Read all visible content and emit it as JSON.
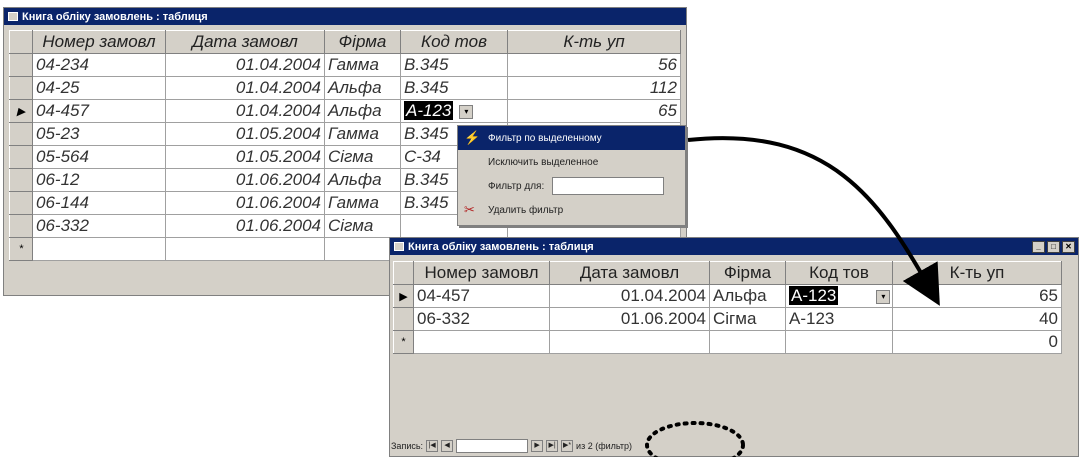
{
  "window1": {
    "title": "Книга обліку замовлень : таблиця",
    "columns": [
      "Номер замовл",
      "Дата замовл",
      "Фірма",
      "Код тов",
      "К-ть уп"
    ],
    "rows": [
      [
        "04-234",
        "01.04.2004",
        "Гамма",
        "B.345",
        "56"
      ],
      [
        "04-25",
        "01.04.2004",
        "Альфа",
        "B.345",
        "112"
      ],
      [
        "04-457",
        "01.04.2004",
        "Альфа",
        "A-123",
        "65"
      ],
      [
        "05-23",
        "01.05.2004",
        "Гамма",
        "B.345",
        ""
      ],
      [
        "05-564",
        "01.05.2004",
        "Сігма",
        "C-34",
        ""
      ],
      [
        "06-12",
        "01.06.2004",
        "Альфа",
        "B.345",
        ""
      ],
      [
        "06-144",
        "01.06.2004",
        "Гамма",
        "B.345",
        ""
      ],
      [
        "06-332",
        "01.06.2004",
        "Сігма",
        "",
        ""
      ]
    ],
    "current_row_marker": "▶",
    "new_row_marker": "*"
  },
  "context_menu": {
    "items": [
      {
        "label": "Фильтр по выделенному",
        "icon": "filter-selection-icon"
      },
      {
        "label": "Исключить выделенное",
        "icon": ""
      },
      {
        "label": "Фильтр для:",
        "icon": ""
      },
      {
        "label": "Удалить фильтр",
        "icon": "remove-filter-icon"
      }
    ]
  },
  "window2": {
    "title": "Книга обліку замовлень : таблиця",
    "columns": [
      "Номер замовл",
      "Дата замовл",
      "Фірма",
      "Код тов",
      "К-ть уп"
    ],
    "rows": [
      [
        "04-457",
        "01.04.2004",
        "Альфа",
        "A-123",
        "65"
      ],
      [
        "06-332",
        "01.06.2004",
        "Сігма",
        "A-123",
        "40"
      ],
      [
        "",
        "",
        "",
        "",
        "0"
      ]
    ],
    "navbar": {
      "label": "Запись:",
      "count_text": "из 2 (фильтр)"
    }
  },
  "colors": {
    "title_bar": "#0a246a",
    "chrome": "#d4d0c8",
    "highlight": "#000000"
  }
}
